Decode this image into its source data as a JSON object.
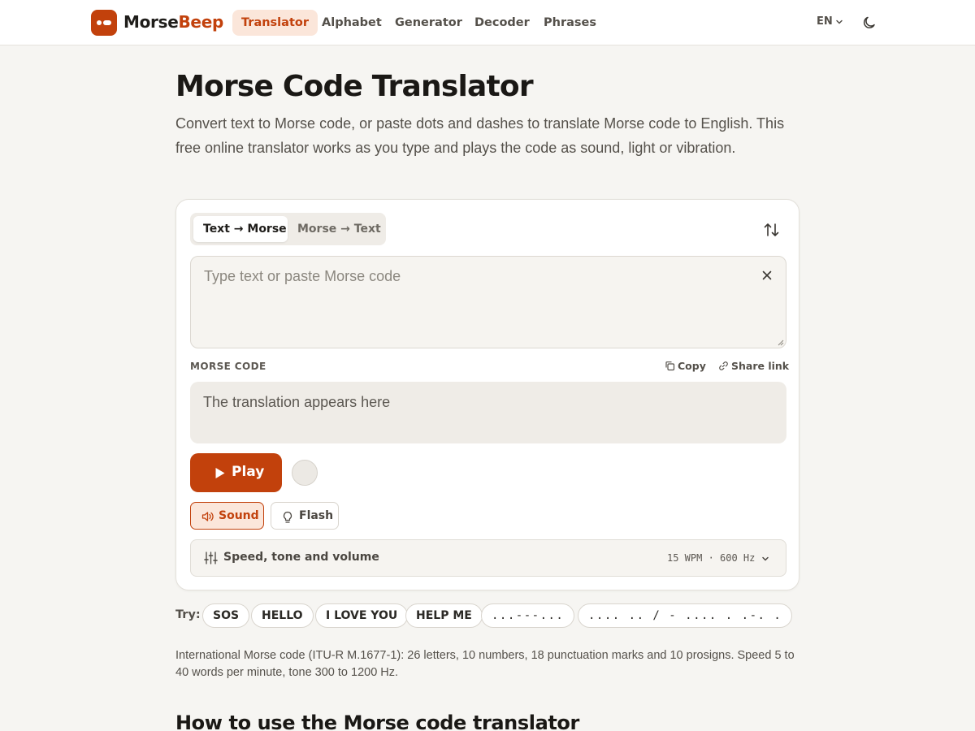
{
  "brand": {
    "name_part1": "Morse",
    "name_part2": "Beep",
    "accent": "#c2410c"
  },
  "nav": {
    "items": [
      {
        "label": "Translator",
        "active": true
      },
      {
        "label": "Alphabet"
      },
      {
        "label": "Generator"
      },
      {
        "label": "Decoder"
      },
      {
        "label": "Phrases"
      }
    ],
    "language": "EN",
    "theme_icon": "moon-icon"
  },
  "hero": {
    "title": "Morse Code Translator",
    "description": "Convert text to Morse code, or paste dots and dashes to translate Morse code to English. This free online translator works as you type and plays the code as sound, light or vibration."
  },
  "translator": {
    "modes": [
      "Text → Morse",
      "Morse → Text"
    ],
    "active_mode": "Text → Morse",
    "swap_icon": "swap-vertical-icon",
    "input": {
      "value": "",
      "placeholder": "Type text or paste Morse code"
    },
    "output_label": "MORSE CODE",
    "copy_label": "Copy",
    "share_label": "Share link",
    "output_placeholder": "The translation appears here",
    "play_label": "Play",
    "output_modes": [
      {
        "label": "Sound",
        "active": true,
        "icon": "speaker-icon"
      },
      {
        "label": "Flash",
        "active": false,
        "icon": "lightbulb-icon"
      }
    ],
    "settings": {
      "label": "Speed, tone and volume",
      "summary": "15 WPM · 600 Hz"
    }
  },
  "try": {
    "label": "Try:",
    "chips": [
      "SOS",
      "HELLO",
      "I LOVE YOU",
      "HELP ME",
      "...---...",
      ".... .. / - .... . .-. ."
    ]
  },
  "footnote": "International Morse code (ITU-R M.1677-1): 26 letters, 10 numbers, 18 punctuation marks and 10 prosigns. Speed 5 to 40 words per minute, tone 300 to 1200 Hz.",
  "how_to_heading": "How to use the Morse code translator"
}
